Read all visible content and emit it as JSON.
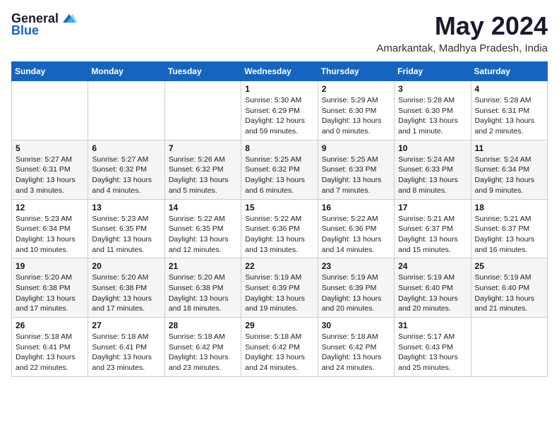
{
  "logo": {
    "general": "General",
    "blue": "Blue"
  },
  "title": "May 2024",
  "location": "Amarkantak, Madhya Pradesh, India",
  "days_of_week": [
    "Sunday",
    "Monday",
    "Tuesday",
    "Wednesday",
    "Thursday",
    "Friday",
    "Saturday"
  ],
  "weeks": [
    [
      {
        "day": "",
        "info": ""
      },
      {
        "day": "",
        "info": ""
      },
      {
        "day": "",
        "info": ""
      },
      {
        "day": "1",
        "info": "Sunrise: 5:30 AM\nSunset: 6:29 PM\nDaylight: 12 hours\nand 59 minutes."
      },
      {
        "day": "2",
        "info": "Sunrise: 5:29 AM\nSunset: 6:30 PM\nDaylight: 13 hours\nand 0 minutes."
      },
      {
        "day": "3",
        "info": "Sunrise: 5:28 AM\nSunset: 6:30 PM\nDaylight: 13 hours\nand 1 minute."
      },
      {
        "day": "4",
        "info": "Sunrise: 5:28 AM\nSunset: 6:31 PM\nDaylight: 13 hours\nand 2 minutes."
      }
    ],
    [
      {
        "day": "5",
        "info": "Sunrise: 5:27 AM\nSunset: 6:31 PM\nDaylight: 13 hours\nand 3 minutes."
      },
      {
        "day": "6",
        "info": "Sunrise: 5:27 AM\nSunset: 6:32 PM\nDaylight: 13 hours\nand 4 minutes."
      },
      {
        "day": "7",
        "info": "Sunrise: 5:26 AM\nSunset: 6:32 PM\nDaylight: 13 hours\nand 5 minutes."
      },
      {
        "day": "8",
        "info": "Sunrise: 5:25 AM\nSunset: 6:32 PM\nDaylight: 13 hours\nand 6 minutes."
      },
      {
        "day": "9",
        "info": "Sunrise: 5:25 AM\nSunset: 6:33 PM\nDaylight: 13 hours\nand 7 minutes."
      },
      {
        "day": "10",
        "info": "Sunrise: 5:24 AM\nSunset: 6:33 PM\nDaylight: 13 hours\nand 8 minutes."
      },
      {
        "day": "11",
        "info": "Sunrise: 5:24 AM\nSunset: 6:34 PM\nDaylight: 13 hours\nand 9 minutes."
      }
    ],
    [
      {
        "day": "12",
        "info": "Sunrise: 5:23 AM\nSunset: 6:34 PM\nDaylight: 13 hours\nand 10 minutes."
      },
      {
        "day": "13",
        "info": "Sunrise: 5:23 AM\nSunset: 6:35 PM\nDaylight: 13 hours\nand 11 minutes."
      },
      {
        "day": "14",
        "info": "Sunrise: 5:22 AM\nSunset: 6:35 PM\nDaylight: 13 hours\nand 12 minutes."
      },
      {
        "day": "15",
        "info": "Sunrise: 5:22 AM\nSunset: 6:36 PM\nDaylight: 13 hours\nand 13 minutes."
      },
      {
        "day": "16",
        "info": "Sunrise: 5:22 AM\nSunset: 6:36 PM\nDaylight: 13 hours\nand 14 minutes."
      },
      {
        "day": "17",
        "info": "Sunrise: 5:21 AM\nSunset: 6:37 PM\nDaylight: 13 hours\nand 15 minutes."
      },
      {
        "day": "18",
        "info": "Sunrise: 5:21 AM\nSunset: 6:37 PM\nDaylight: 13 hours\nand 16 minutes."
      }
    ],
    [
      {
        "day": "19",
        "info": "Sunrise: 5:20 AM\nSunset: 6:38 PM\nDaylight: 13 hours\nand 17 minutes."
      },
      {
        "day": "20",
        "info": "Sunrise: 5:20 AM\nSunset: 6:38 PM\nDaylight: 13 hours\nand 17 minutes."
      },
      {
        "day": "21",
        "info": "Sunrise: 5:20 AM\nSunset: 6:38 PM\nDaylight: 13 hours\nand 18 minutes."
      },
      {
        "day": "22",
        "info": "Sunrise: 5:19 AM\nSunset: 6:39 PM\nDaylight: 13 hours\nand 19 minutes."
      },
      {
        "day": "23",
        "info": "Sunrise: 5:19 AM\nSunset: 6:39 PM\nDaylight: 13 hours\nand 20 minutes."
      },
      {
        "day": "24",
        "info": "Sunrise: 5:19 AM\nSunset: 6:40 PM\nDaylight: 13 hours\nand 20 minutes."
      },
      {
        "day": "25",
        "info": "Sunrise: 5:19 AM\nSunset: 6:40 PM\nDaylight: 13 hours\nand 21 minutes."
      }
    ],
    [
      {
        "day": "26",
        "info": "Sunrise: 5:18 AM\nSunset: 6:41 PM\nDaylight: 13 hours\nand 22 minutes."
      },
      {
        "day": "27",
        "info": "Sunrise: 5:18 AM\nSunset: 6:41 PM\nDaylight: 13 hours\nand 23 minutes."
      },
      {
        "day": "28",
        "info": "Sunrise: 5:18 AM\nSunset: 6:42 PM\nDaylight: 13 hours\nand 23 minutes."
      },
      {
        "day": "29",
        "info": "Sunrise: 5:18 AM\nSunset: 6:42 PM\nDaylight: 13 hours\nand 24 minutes."
      },
      {
        "day": "30",
        "info": "Sunrise: 5:18 AM\nSunset: 6:42 PM\nDaylight: 13 hours\nand 24 minutes."
      },
      {
        "day": "31",
        "info": "Sunrise: 5:17 AM\nSunset: 6:43 PM\nDaylight: 13 hours\nand 25 minutes."
      },
      {
        "day": "",
        "info": ""
      }
    ]
  ]
}
